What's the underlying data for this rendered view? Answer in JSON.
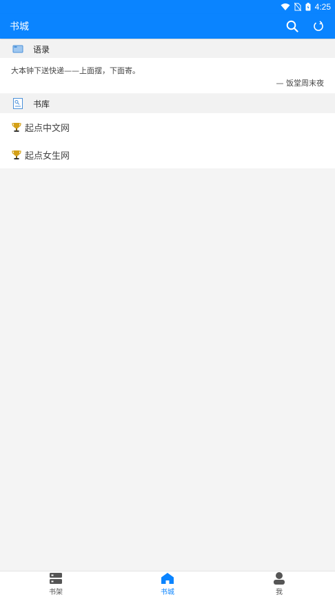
{
  "status_bar": {
    "time": "4:25"
  },
  "app_bar": {
    "title": "书城"
  },
  "quotes_section": {
    "title": "语录"
  },
  "quote": {
    "text": "大本钟下送快递——上面摆，下面寄。",
    "source": "— 饭堂周末夜"
  },
  "library_section": {
    "title": "书库"
  },
  "library_items": [
    {
      "label": "起点中文网"
    },
    {
      "label": "起点女生网"
    }
  ],
  "bottom_nav": {
    "items": [
      {
        "label": "书架"
      },
      {
        "label": "书城"
      },
      {
        "label": "我"
      }
    ],
    "active": "书城"
  },
  "colors": {
    "primary": "#0a84ff",
    "background": "#f4f4f4",
    "trophy": "#d4a017"
  }
}
